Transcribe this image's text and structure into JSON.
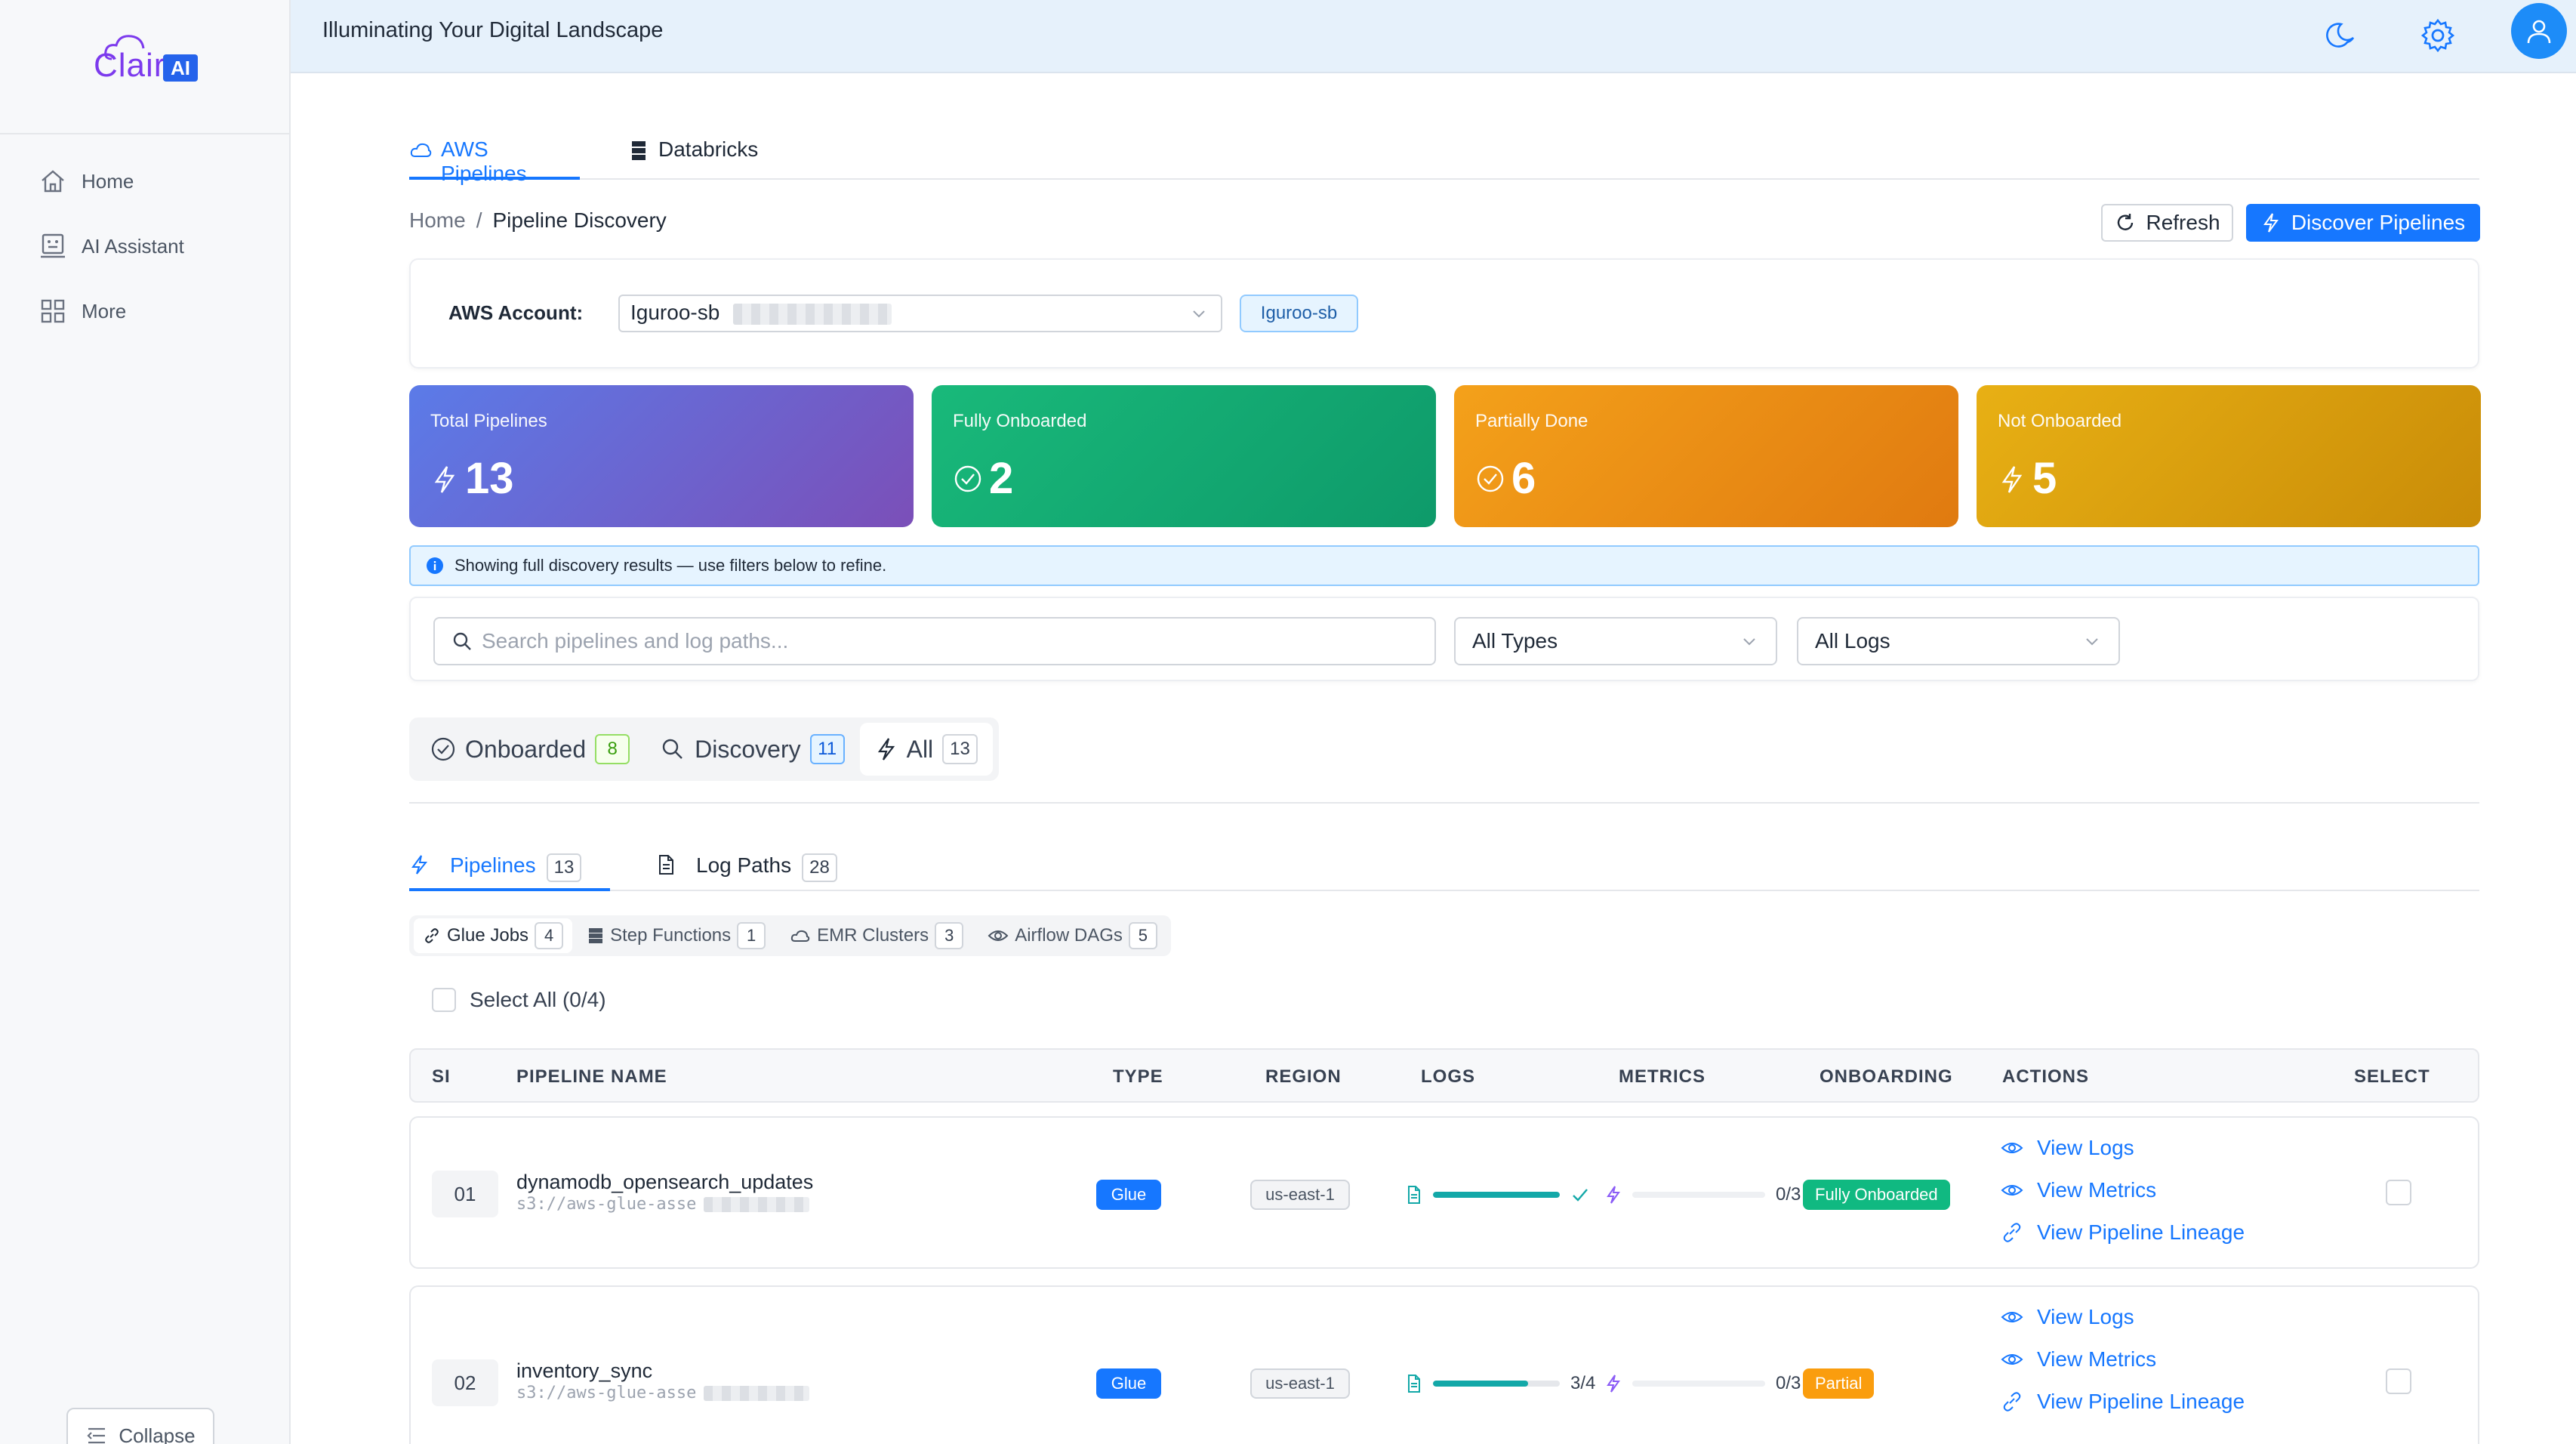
{
  "sidebar": {
    "logo_text": "Clair",
    "logo_badge": "AI",
    "items": [
      {
        "label": "Home",
        "icon": "home-icon"
      },
      {
        "label": "AI Assistant",
        "icon": "robot-icon"
      },
      {
        "label": "More",
        "icon": "grid-icon"
      }
    ],
    "collapse_label": "Collapse"
  },
  "header": {
    "title": "Illuminating Your Digital Landscape",
    "icons": [
      "moon-icon",
      "gear-icon",
      "user-icon"
    ]
  },
  "top_tabs": [
    {
      "label": "AWS Pipelines",
      "icon": "cloud-icon",
      "active": true
    },
    {
      "label": "Databricks",
      "icon": "server-icon",
      "active": false
    }
  ],
  "breadcrumb": {
    "root": "Home",
    "separator": "/",
    "current": "Pipeline Discovery"
  },
  "toolbar": {
    "refresh_label": "Refresh",
    "discover_label": "Discover Pipelines"
  },
  "account": {
    "label": "AWS Account:",
    "value": "Iguroo-sb",
    "chip": "Iguroo-sb"
  },
  "stats": [
    {
      "label": "Total Pipelines",
      "value": "13",
      "icon": "lightning-icon",
      "gradient": [
        "#5b7be8",
        "#7b4fb8"
      ]
    },
    {
      "label": "Fully Onboarded",
      "value": "2",
      "icon": "check-circle-icon",
      "gradient": [
        "#19b97a",
        "#0e9a6a"
      ]
    },
    {
      "label": "Partially Done",
      "value": "6",
      "icon": "check-circle-icon",
      "gradient": [
        "#f4a11a",
        "#e07a10"
      ]
    },
    {
      "label": "Not Onboarded",
      "value": "5",
      "icon": "lightning-icon",
      "gradient": [
        "#e8b014",
        "#c98c08"
      ]
    }
  ],
  "info_message": "Showing full discovery results — use filters below to refine.",
  "filters": {
    "search_placeholder": "Search pipelines and log paths...",
    "type_select": "All Types",
    "logs_select": "All Logs"
  },
  "segments": [
    {
      "label": "Onboarded",
      "count": "8",
      "icon": "check-circle-icon"
    },
    {
      "label": "Discovery",
      "count": "11",
      "icon": "search-icon"
    },
    {
      "label": "All",
      "count": "13",
      "icon": "lightning-icon",
      "active": true
    }
  ],
  "mid_tabs": [
    {
      "label": "Pipelines",
      "count": "13",
      "icon": "lightning-icon",
      "active": true
    },
    {
      "label": "Log Paths",
      "count": "28",
      "icon": "file-icon"
    }
  ],
  "type_chips": [
    {
      "label": "Glue Jobs",
      "count": "4",
      "icon": "link-icon",
      "active": true
    },
    {
      "label": "Step Functions",
      "count": "1",
      "icon": "server-icon"
    },
    {
      "label": "EMR Clusters",
      "count": "3",
      "icon": "cloud-icon"
    },
    {
      "label": "Airflow DAGs",
      "count": "5",
      "icon": "eye-icon"
    }
  ],
  "select_all_label": "Select All (0/4)",
  "table": {
    "columns": [
      "SI",
      "PIPELINE NAME",
      "TYPE",
      "REGION",
      "LOGS",
      "METRICS",
      "ONBOARDING",
      "ACTIONS",
      "SELECT"
    ],
    "actions": [
      "View Logs",
      "View Metrics",
      "View Pipeline Lineage"
    ],
    "rows": [
      {
        "sl": "01",
        "name": "dynamodb_opensearch_updates",
        "path": "s3://aws-glue-asse",
        "type": "Glue",
        "region": "us-east-1",
        "logs_fraction": 1.0,
        "logs_text": "",
        "metrics_text": "0/3",
        "onboarding": "Fully Onboarded",
        "onboarding_color": "#10b981"
      },
      {
        "sl": "02",
        "name": "inventory_sync",
        "path": "s3://aws-glue-asse",
        "type": "Glue",
        "region": "us-east-1",
        "logs_fraction": 0.75,
        "logs_text": "3/4",
        "metrics_text": "0/3",
        "onboarding": "Partial",
        "onboarding_color": "#fa9d0e"
      }
    ]
  },
  "colors": {
    "accent": "#1677ff",
    "header_bg": "#e6f1fb"
  }
}
